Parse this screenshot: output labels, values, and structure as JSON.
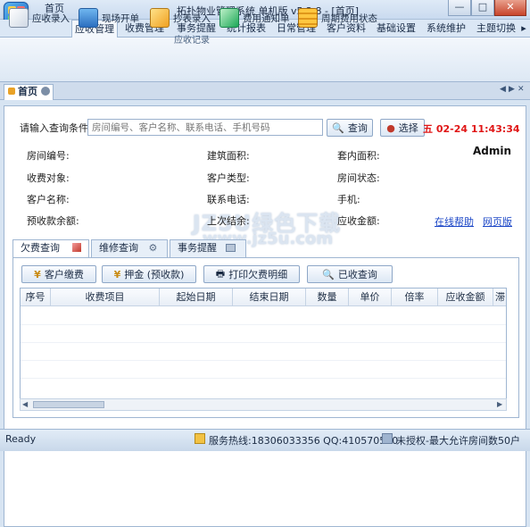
{
  "window": {
    "title": "拓扑物业管理系统 单机版 v5.2.8 - [首页]",
    "minimize": "—",
    "maximize": "□",
    "close": "✕"
  },
  "menu": {
    "items": [
      "首页",
      "应收管理",
      "收费管理",
      "事务提醒",
      "统计报表",
      "日常管理",
      "客户资料",
      "基础设置",
      "系统维护",
      "主题切换"
    ],
    "active": "应收管理",
    "more": "▸"
  },
  "ribbon": {
    "buttons": [
      {
        "label": "应收录入",
        "icon": "notebook-pen-icon"
      },
      {
        "label": "现场开单",
        "icon": "monitor-chart-icon"
      },
      {
        "label": "抄表录入",
        "icon": "pencil-icon"
      },
      {
        "label": "费用通知单",
        "icon": "notice-icon"
      },
      {
        "label": "周期费用状态",
        "icon": "stack-list-icon"
      }
    ],
    "group_label": "应收记录"
  },
  "tabs": {
    "home": "首页"
  },
  "search": {
    "prompt": "请输入查询条件",
    "placeholder": "房间编号、客户名称、联系电话、手机号码",
    "query_button": "查询",
    "select_button": "选择"
  },
  "clock": "五 02-24 11:43:34",
  "user": "Admin",
  "info": {
    "room_no": "房间编号:",
    "build_area": "建筑面积:",
    "inner_area": "套内面积:",
    "charge_target": "收费对象:",
    "customer_type": "客户类型:",
    "room_status": "房间状态:",
    "customer_name": "客户名称:",
    "phone": "联系电话:",
    "mobile": "手机:",
    "prepaid_balance": "预收款余额:",
    "last_settle": "上次结余:",
    "receivable_amount": "应收金额:",
    "online_help": "在线帮助",
    "web_version": "网页版"
  },
  "watermark": {
    "line1": "JZ5U绿色下载",
    "line2": "www.jz5u.com"
  },
  "subtabs": [
    {
      "label": "欠费查询",
      "icon": "cube-icon"
    },
    {
      "label": "维修查询",
      "icon": "gears-icon"
    },
    {
      "label": "事务提醒",
      "icon": "tray-icon"
    }
  ],
  "actions": {
    "pay": "客户缴费",
    "deposit": "押金 (预收款)",
    "print": "打印欠费明细",
    "received": "已收查询"
  },
  "grid": {
    "columns": [
      "序号",
      "收费项目",
      "起始日期",
      "结束日期",
      "数量",
      "单价",
      "倍率",
      "应收金额",
      "滞"
    ]
  },
  "status": {
    "ready": "Ready",
    "service": "服务热线:18306033356 QQ:410570560",
    "license": "未授权-最大允许房间数50户"
  }
}
